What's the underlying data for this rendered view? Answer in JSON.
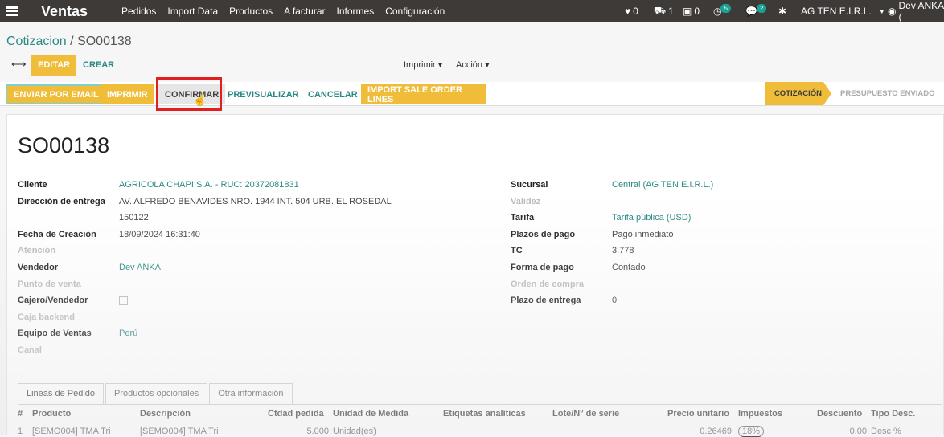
{
  "navbar": {
    "app": "Ventas",
    "menus": [
      "Pedidos",
      "Import Data",
      "Productos",
      "A facturar",
      "Informes",
      "Configuración"
    ],
    "systray": {
      "heart": "0",
      "truck": "1",
      "money": "0",
      "activity_badge": "5",
      "chat_badge": "2",
      "company": "AG TEN E.I.R.L.",
      "user": "Dev ANKA ("
    }
  },
  "breadcrumb": {
    "parent": "Cotizacion",
    "separator": "/",
    "current": "SO00138"
  },
  "controls": {
    "edit": "EDITAR",
    "create": "CREAR",
    "print": "Imprimir",
    "action": "Acción"
  },
  "actions": {
    "send_email": "ENVIAR POR EMAIL",
    "print": "IMPRIMIR",
    "confirm": "CONFIRMAR",
    "preview": "PREVISUALIZAR",
    "cancel": "CANCELAR",
    "import_lines": "IMPORT SALE ORDER LINES"
  },
  "status": {
    "stages": [
      "COTIZACIÓN",
      "PRESUPUESTO ENVIADO"
    ],
    "active": "COTIZACIÓN"
  },
  "form": {
    "name": "SO00138",
    "left": [
      {
        "label": "Cliente",
        "value": "AGRICOLA CHAPI S.A. - RUC: 20372081831",
        "link": true
      },
      {
        "label": "Dirección de entrega",
        "value": "AV. ALFREDO BENAVIDES NRO. 1944 INT. 504 URB. EL ROSEDAL"
      },
      {
        "label": "",
        "value": "150122"
      },
      {
        "label": "Fecha de Creación",
        "value": "18/09/2024 16:31:40"
      },
      {
        "label": "Atención",
        "value": "",
        "muted": true
      },
      {
        "label": "Vendedor",
        "value": "Dev ANKA",
        "link": true
      },
      {
        "label": "Punto de venta",
        "value": "",
        "muted": true
      },
      {
        "label": "Cajero/Vendedor",
        "value": "",
        "checkbox": true
      },
      {
        "label": "Caja backend",
        "value": "",
        "muted": true
      },
      {
        "label": "Equipo de Ventas",
        "value": "Perú",
        "link": true
      },
      {
        "label": "Canal",
        "value": "",
        "muted": true
      }
    ],
    "right": [
      {
        "label": "Sucursal",
        "value": "Central (AG TEN E.I.R.L.)",
        "link": true
      },
      {
        "label": "Validez",
        "value": "",
        "muted": true
      },
      {
        "label": "Tarifa",
        "value": "Tarifa pública (USD)",
        "link": true
      },
      {
        "label": "Plazos de pago",
        "value": "Pago inmediato"
      },
      {
        "label": "TC",
        "value": "3.778"
      },
      {
        "label": "Forma de pago",
        "value": "Contado"
      },
      {
        "label": "Orden de compra",
        "value": "",
        "muted": true
      },
      {
        "label": "Plazo de entrega",
        "value": "0"
      }
    ]
  },
  "tabs": [
    "Lineas de Pedido",
    "Productos opcionales",
    "Otra información"
  ],
  "table": {
    "headers": [
      "#",
      "Producto",
      "Descripción",
      "Ctdad pedida",
      "Unidad de Medida",
      "Etiquetas analíticas",
      "Lote/N° de serie",
      "Precio unitario",
      "Impuestos",
      "Descuento",
      "Tipo Desc."
    ],
    "rows": [
      [
        "1",
        "[SEMO004] TMA Tri",
        "[SEMO004] TMA Tri",
        "5.000",
        "Unidad(es)",
        "",
        "",
        "0.26469",
        "18%",
        "0.00",
        "Desc %"
      ]
    ]
  },
  "colors": {
    "accent": "#2a8a84",
    "primary": "#f0bd3a",
    "navbar": "#3d3a38",
    "highlight": "#e02020"
  }
}
